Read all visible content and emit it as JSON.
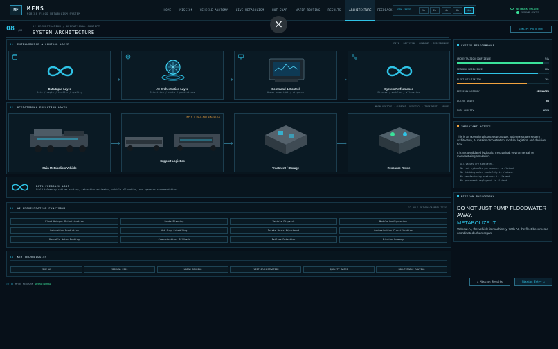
{
  "app": {
    "logo": "MF",
    "name": "MFMS",
    "subtitle": "MOBILE FLOOD METABOLISM SYSTEM"
  },
  "nav": [
    "HOME",
    "MISSION",
    "VEHICLE ANATOMY",
    "LIVE METABOLISM",
    "HOT-SWAP",
    "WATER ROUTING",
    "RESULTS",
    "ARCHITECTURE",
    "FEEDBACK"
  ],
  "nav_active": "ARCHITECTURE",
  "speed": {
    "label": "SIM SPEED",
    "options": [
      "1x",
      "2x",
      "4x",
      "8x",
      "16x"
    ],
    "selected": "16x"
  },
  "network": {
    "status": "NETWORK ONLINE",
    "sub": "COMMAND CENTER"
  },
  "header": {
    "section_number": "08",
    "section_total": "/08",
    "breadcrumb": "AI ORCHESTRATION / OPERATIONAL CONCEPT",
    "title": "SYSTEM ARCHITECTURE",
    "badge": "CONCEPT PROTOTYPE"
  },
  "intel": {
    "title": "INTELLIGENCE & CONTROL LAYER",
    "num": "01",
    "flow": "DATA → DECISION → COMMAND → PERFORMANCE",
    "cards": [
      {
        "name": "Data Input Layer",
        "desc": "Rain / depth / traffic / quality",
        "icon": "database-icon"
      },
      {
        "name": "AI Orchestration Layer",
        "desc": "Prioritize / route / predictions",
        "icon": "brain-icon"
      },
      {
        "name": "Command & Control",
        "desc": "Human oversight / dispatch",
        "icon": "monitor-icon"
      },
      {
        "name": "System Performance",
        "desc": "Fitness / modules / allocation",
        "icon": "network-icon"
      }
    ]
  },
  "ops": {
    "title": "OPERATIONAL EXECUTION LAYER",
    "num": "02",
    "flow": "MAIN VEHICLE → SUPPORT LOGISTICS → TREATMENT → REUSE",
    "tag": "EMPTY / FULL-MOD LOGISTICS",
    "cards": [
      {
        "name": "Main Metabolism Vehicle"
      },
      {
        "name": "Support Logistics"
      },
      {
        "name": "Treatment / Storage"
      },
      {
        "name": "Resource Reuse"
      }
    ]
  },
  "feedback": {
    "title": "DATA FEEDBACK LOOP",
    "desc": "Field telemetry refines routing, saturation estimates, vehicle allocation, and operator recommendations."
  },
  "ai_functions": {
    "num": "03",
    "title": "AI ORCHESTRATION FUNCTIONS",
    "right": "12 RULE-DRIVEN CAPABILITIES",
    "items": [
      "Flood Hotspot Prioritization",
      "Route Planning",
      "Vehicle Dispatch",
      "Module Configuration",
      "Saturation Prediction",
      "Hot-Swap Scheduling",
      "Intake Power Adjustment",
      "Contamination Classification",
      "Reusable-Water Routing",
      "Communications Fallback",
      "Failure Detection",
      "Mission Summary"
    ]
  },
  "key_tech": {
    "num": "04",
    "title": "KEY TECHNOLOGIES",
    "items": [
      "EDGE AI",
      "MODULAR PODS",
      "URBAN SENSING",
      "FLEET ORCHESTRATION",
      "QUALITY GATES",
      "NON-POTABLE ROUTING"
    ]
  },
  "performance": {
    "title": "SYSTEM PERFORMANCE",
    "bars": [
      {
        "label": "ORCHESTRATION CONFIDENCE",
        "value": "94%",
        "fraction": 0.94,
        "color": "#3ae29a"
      },
      {
        "label": "NETWORK RESILIENCE",
        "value": "88%",
        "fraction": 0.88,
        "color": "#2fc3e6"
      },
      {
        "label": "FLEET UTILIZATION",
        "value": "76%",
        "fraction": 0.76,
        "color": "#f0a340"
      }
    ],
    "stats": [
      {
        "label": "DECISION LATENCY",
        "value": "SIMULATED",
        "color": "#e8f4f8"
      },
      {
        "label": "ACTIVE UNITS",
        "value": "03",
        "color": "#e8f4f8"
      },
      {
        "label": "DATA QUALITY",
        "value": "HIGH",
        "color": "#3ae29a"
      }
    ]
  },
  "notice": {
    "title": "IMPORTANT NOTICE",
    "body": "This is an operational concept prototype. It demonstrates system architecture, AI mission orchestration, modular logistics, and decision flow.",
    "body2": "It is not a validated hydraulic, mechanical, environmental, or manufacturing simulation.",
    "bullets": [
      "All values are simulated.",
      "No real hydraulic performance is claimed.",
      "No drinking-water capability is claimed.",
      "No manufacturing readiness is claimed.",
      "No government deployment is claimed."
    ]
  },
  "philosophy": {
    "title": "MISSION PHILOSOPHY",
    "line1": "DO NOT JUST PUMP FLOODWATER AWAY.",
    "line2": "METABOLIZE IT.",
    "body": "Without AI, the vehicle is machinery. With AI, the fleet becomes a coordinated urban organ."
  },
  "footer": {
    "network_label": "MFMS NETWORK",
    "network_status": "OPERATIONAL",
    "prev": "← Mission Results",
    "next": "Mission Entry →"
  },
  "close_icon": "×"
}
